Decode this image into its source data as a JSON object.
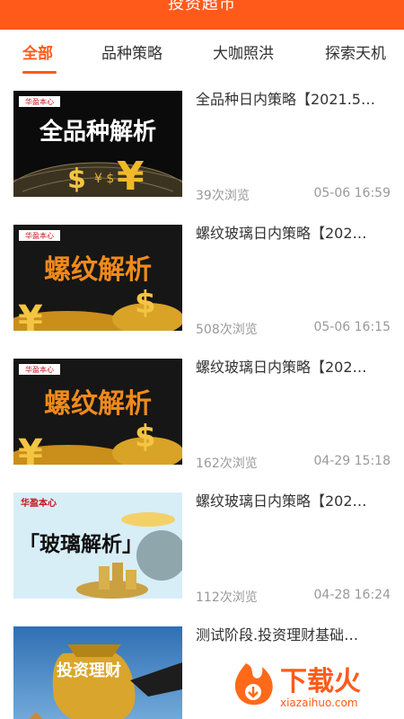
{
  "header": {
    "title": "投资超市"
  },
  "tabs": [
    {
      "label": "全部"
    },
    {
      "label": "品种策略"
    },
    {
      "label": "大咖照洪"
    },
    {
      "label": "探索天机"
    }
  ],
  "articles": [
    {
      "title": "全品种日内策略【2021.5…",
      "views": "39次浏览",
      "time": "05-06 16:59",
      "thumb_brand": "华盈本心",
      "thumb_text": "全品种解析"
    },
    {
      "title": "螺纹玻璃日内策略【202…",
      "views": "508次浏览",
      "time": "05-06 16:15",
      "thumb_brand": "华盈本心",
      "thumb_text": "螺纹解析"
    },
    {
      "title": "螺纹玻璃日内策略【202…",
      "views": "162次浏览",
      "time": "04-29 15:18",
      "thumb_brand": "华盈本心",
      "thumb_text": "螺纹解析"
    },
    {
      "title": "螺纹玻璃日内策略【202…",
      "views": "112次浏览",
      "time": "04-28 16:24",
      "thumb_brand": "华盈本心",
      "thumb_text": "「玻璃解析」"
    },
    {
      "title": "测试阶段.投资理财基础…",
      "views": "",
      "time": "",
      "thumb_brand": "",
      "thumb_text": "投资理财"
    }
  ],
  "watermark": {
    "text": "下载火",
    "url": "xiazaihuo.com"
  },
  "colors": {
    "accent": "#ff5a1a",
    "muted": "#999999"
  }
}
